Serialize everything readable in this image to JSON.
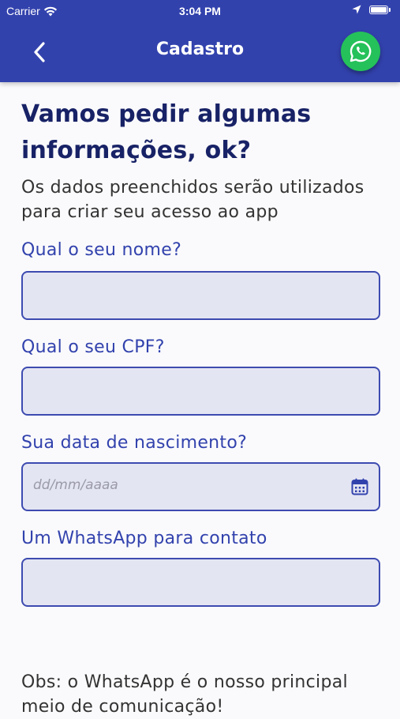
{
  "status_bar": {
    "carrier": "Carrier",
    "time": "3:04 PM"
  },
  "header": {
    "title": "Cadastro",
    "background": "#3242ad",
    "whatsapp_color": "#25c15a"
  },
  "intro": {
    "heading": "Vamos pedir algumas informações, ok?",
    "subtitle": "Os dados preenchidos serão utilizados para criar seu acesso ao app"
  },
  "form": {
    "name_label": "Qual o seu nome?",
    "name_value": "",
    "cpf_label": "Qual o seu CPF?",
    "cpf_value": "",
    "birth_label": "Sua data de nascimento?",
    "birth_placeholder": "dd/mm/aaaa",
    "whatsapp_label": "Um WhatsApp para contato",
    "whatsapp_value": ""
  },
  "note": {
    "text": "Obs: o WhatsApp é o nosso principal meio de comunicação!"
  },
  "icons": {
    "back": "chevron-left-icon",
    "whatsapp": "whatsapp-icon",
    "calendar": "calendar-icon",
    "wifi": "wifi-icon",
    "location": "location-arrow-icon",
    "battery": "battery-icon"
  }
}
